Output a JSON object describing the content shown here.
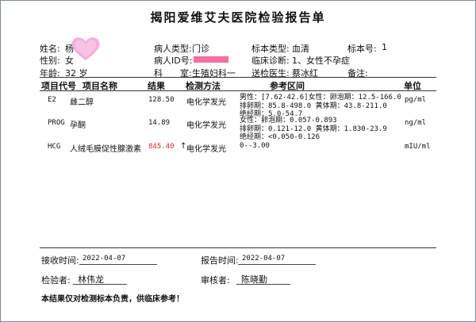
{
  "title": "揭阳爱维艾夫医院检验报告单",
  "patient": {
    "name_label": "姓名:",
    "name_value": "杨",
    "gender_label": "性别:",
    "gender_value": "女",
    "age_label": "年龄:",
    "age_value": "32 岁",
    "type_label": "病人类型:",
    "type_value": "门诊",
    "id_label": "病人ID号:",
    "dept_label": "科　　室:",
    "dept_value": "生殖妇科一",
    "sample_type_label": "标本类型:",
    "sample_type_value": "血清",
    "sample_no_label": "标本号:",
    "sample_no_value": "1",
    "diagnosis_label": "临床诊断:",
    "diagnosis_value": "1、女性不孕症",
    "doctor_label": "送检医生:",
    "doctor_value": "蔡冰红",
    "remark_label": "备注:"
  },
  "table": {
    "headers": {
      "code": "项目代号",
      "name": "项目名称",
      "result": "结果",
      "method": "检测方法",
      "reference": "参考区间",
      "unit": "单位"
    },
    "rows": [
      {
        "code": "E2",
        "name": "雌二醇",
        "result": "128.50",
        "flag": "",
        "method": "电化学发光",
        "reference": [
          "男性：[7.62-42.6]女性：卵泡期：12.5-166.0",
          "排卵期：85.8-498.0 黄体期：43.8-211.0",
          "绝经期：5.0-54.7"
        ],
        "unit": "pg/ml"
      },
      {
        "code": "PROG",
        "name": "孕酮",
        "result": "14.89",
        "flag": "",
        "method": "电化学发光",
        "reference": [
          "女性：卵泡期：0.057-0.893",
          "排卵期：0.121-12.0 黄体期：1.830-23.9",
          "绝经期：<0.050-0.126"
        ],
        "unit": "ng/ml"
      },
      {
        "code": "HCG",
        "name": "人绒毛膜促性腺激素",
        "result": "845.40",
        "flag": "↑",
        "method": "电化学发光",
        "reference": [
          "0--3.00"
        ],
        "unit": "mIU/ml"
      }
    ]
  },
  "footer": {
    "receive_label": "接收时间:",
    "receive_value": "2022-04-07",
    "report_label": "报告时间:",
    "report_value": "2022-04-07",
    "examiner_label": "检验者:",
    "examiner_value": "林伟龙",
    "reviewer_label": "审核者:",
    "reviewer_value": "陈晓勤",
    "note": "本结果仅对检测标本负责，供临床参考！"
  },
  "colors": {
    "abnormal": "#e0262a",
    "heart": "#f4a6d7",
    "redaction": "#f26fa0"
  },
  "icons": {
    "name_cover": "heart-sticker-icon",
    "id_cover": "redaction-bar"
  }
}
